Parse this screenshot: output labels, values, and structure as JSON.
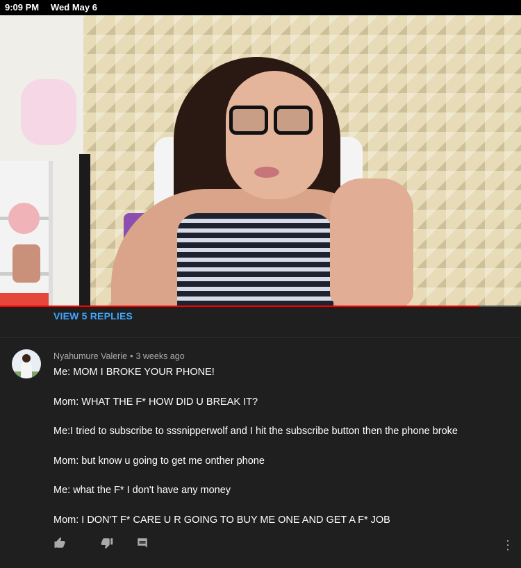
{
  "status_bar": {
    "time": "9:09 PM",
    "date": "Wed May 6"
  },
  "video": {
    "progress": 0.92
  },
  "replies": {
    "label": "VIEW 5 REPLIES"
  },
  "comment": {
    "author": "Nyahumure Valerie",
    "separator": "•",
    "time_ago": "3 weeks ago",
    "lines": [
      "Me: MOM I BROKE YOUR PHONE!",
      "Mom: WHAT THE F* HOW DID U BREAK IT?",
      "Me:I tried to subscribe to sssnipperwolf and I hit the subscribe button then the phone broke",
      "Mom: but know u going to get me onther phone",
      "Me: what the F* I don't have any money",
      "Mom: I DON'T F* CARE U R GOING TO BUY ME ONE AND GET A F* JOB"
    ],
    "actions": {
      "like_icon": "thumbs-up-icon",
      "dislike_icon": "thumbs-down-icon",
      "reply_icon": "comment-icon",
      "more_icon": "more-vertical-icon"
    }
  },
  "colors": {
    "accent": "#3ea6ff",
    "progress": "#ff0000",
    "background": "#1f1f1f"
  }
}
